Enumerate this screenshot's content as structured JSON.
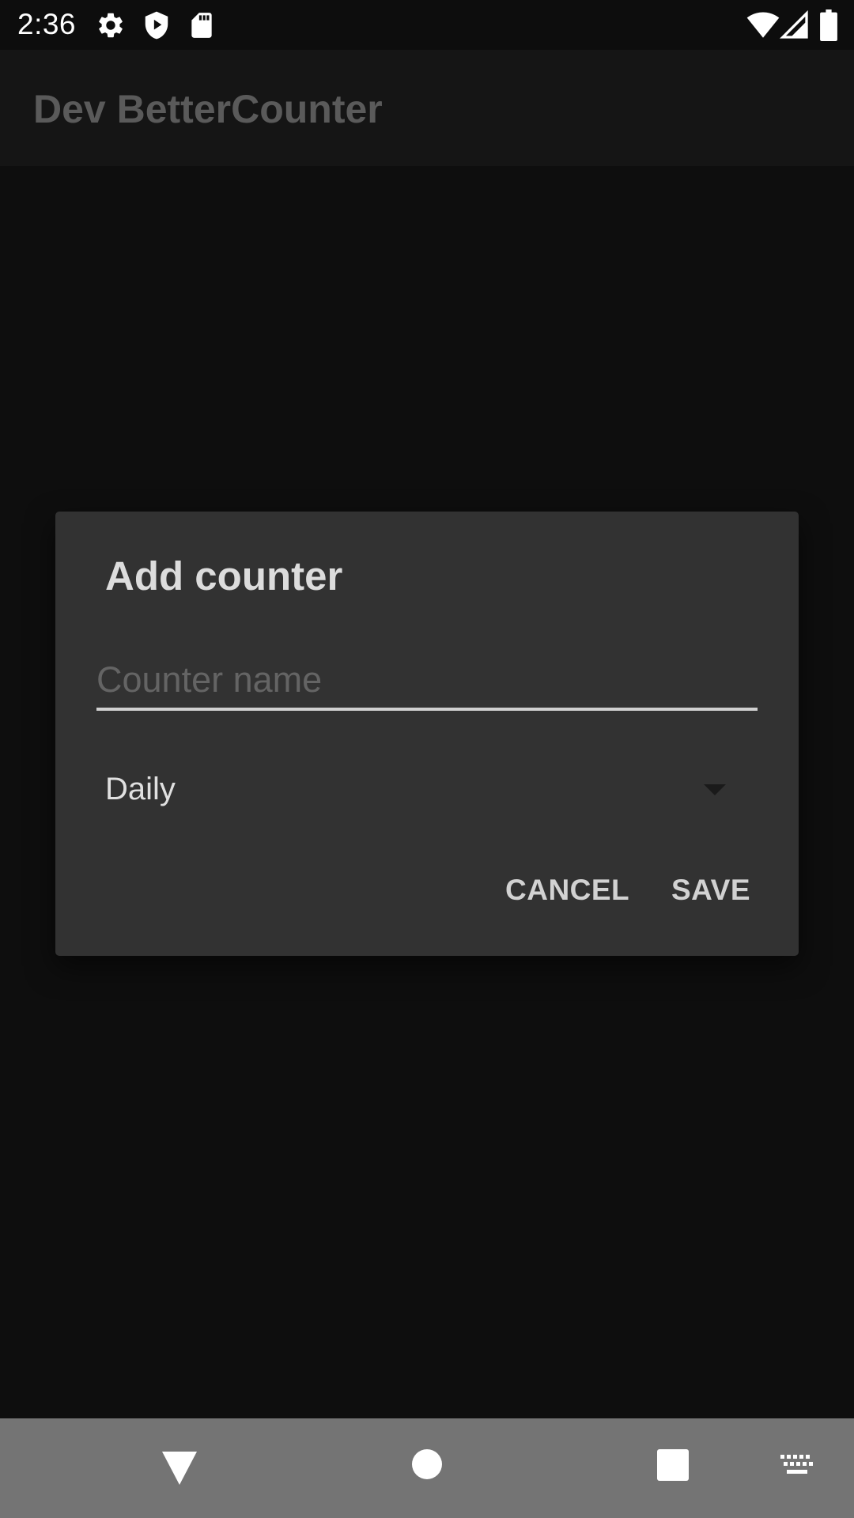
{
  "status_bar": {
    "time": "2:36",
    "icons": [
      "settings-icon",
      "shield-play-icon",
      "sd-card-icon",
      "wifi-icon",
      "cell-signal-icon",
      "battery-icon"
    ]
  },
  "app_bar": {
    "title": "Dev BetterCounter"
  },
  "dialog": {
    "title": "Add counter",
    "name_input": {
      "value": "",
      "placeholder": "Counter name"
    },
    "frequency": {
      "selected": "Daily"
    },
    "buttons": {
      "cancel": "CANCEL",
      "save": "SAVE"
    }
  },
  "nav_bar": {
    "icons": [
      "back-icon",
      "home-icon",
      "recents-icon",
      "keyboard-icon"
    ]
  },
  "colors": {
    "background": "#0e0e0e",
    "app_bar": "#151515",
    "dialog": "#323232",
    "nav_bar": "#747474",
    "text_primary": "#dcdcdc",
    "text_hint": "#646464"
  }
}
